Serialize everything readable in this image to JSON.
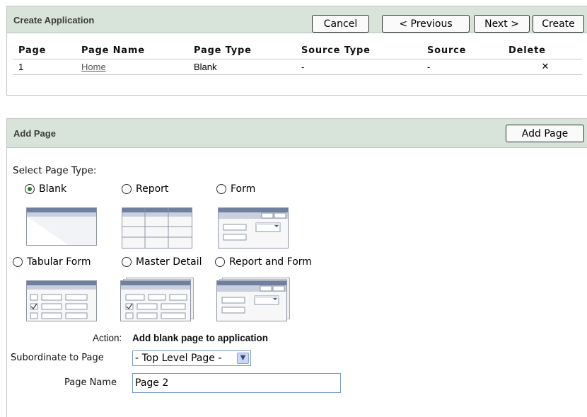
{
  "create_region": {
    "title": "Create Application",
    "buttons": {
      "cancel": "Cancel",
      "previous": "< Previous",
      "next": "Next >",
      "create": "Create"
    },
    "columns": [
      "Page",
      "Page Name",
      "Page Type",
      "Source Type",
      "Source",
      "Delete"
    ],
    "rows": [
      {
        "page": "1",
        "page_name": "Home",
        "page_type": "Blank",
        "source_type": "-",
        "source": "-",
        "delete": "✕"
      }
    ]
  },
  "add_region": {
    "title": "Add Page",
    "add_button": "Add Page",
    "select_label": "Select Page Type:",
    "page_types": [
      {
        "label": "Blank",
        "selected": true,
        "icon": "blank-page-icon"
      },
      {
        "label": "Report",
        "selected": false,
        "icon": "report-page-icon"
      },
      {
        "label": "Form",
        "selected": false,
        "icon": "form-page-icon"
      },
      {
        "label": "Tabular Form",
        "selected": false,
        "icon": "tabular-form-page-icon"
      },
      {
        "label": "Master Detail",
        "selected": false,
        "icon": "master-detail-page-icon"
      },
      {
        "label": "Report and Form",
        "selected": false,
        "icon": "report-and-form-page-icon"
      }
    ],
    "action_label": "Action:",
    "action_value": "Add blank page to application",
    "subordinate_label": "Subordinate to Page",
    "subordinate_value": "- Top Level Page -",
    "page_name_label": "Page Name",
    "page_name_value": "Page 2"
  },
  "colors": {
    "header_bg": "#d8e4da",
    "thumb_bar": "#6e7fa0",
    "radio_dot": "#2c7a2c"
  }
}
